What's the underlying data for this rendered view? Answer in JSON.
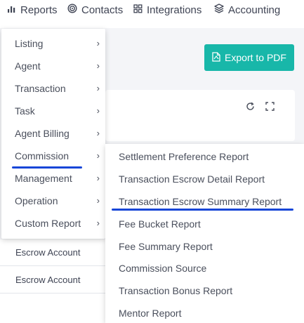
{
  "topnav": {
    "items": [
      {
        "label": "Reports",
        "icon": "bar-chart-icon"
      },
      {
        "label": "Contacts",
        "icon": "target-icon"
      },
      {
        "label": "Integrations",
        "icon": "grid-icon"
      },
      {
        "label": "Accounting",
        "icon": "layers-icon"
      }
    ]
  },
  "toolbar": {
    "export_label": "Export to PDF",
    "export_icon": "pdf-file-icon",
    "refresh_icon": "refresh-icon",
    "expand_icon": "expand-icon"
  },
  "background_list": {
    "rows": [
      "Escrow Account",
      "Escrow Account"
    ]
  },
  "menu": {
    "items": [
      {
        "label": "Listing"
      },
      {
        "label": "Agent"
      },
      {
        "label": "Transaction"
      },
      {
        "label": "Task"
      },
      {
        "label": "Agent Billing"
      },
      {
        "label": "Commission"
      },
      {
        "label": "Management"
      },
      {
        "label": "Operation"
      },
      {
        "label": "Custom Report"
      }
    ],
    "chevron": "›"
  },
  "submenu": {
    "items": [
      {
        "label": "Settlement Preference Report"
      },
      {
        "label": "Transaction Escrow Detail Report"
      },
      {
        "label": "Transaction Escrow Summary Report"
      },
      {
        "label": "Fee Bucket Report"
      },
      {
        "label": "Fee Summary Report"
      },
      {
        "label": "Commission Source"
      },
      {
        "label": "Transaction Bonus Report"
      },
      {
        "label": "Mentor Report"
      }
    ]
  },
  "colors": {
    "accent": "#18b7a9",
    "highlight_underline": "#1746d8"
  }
}
